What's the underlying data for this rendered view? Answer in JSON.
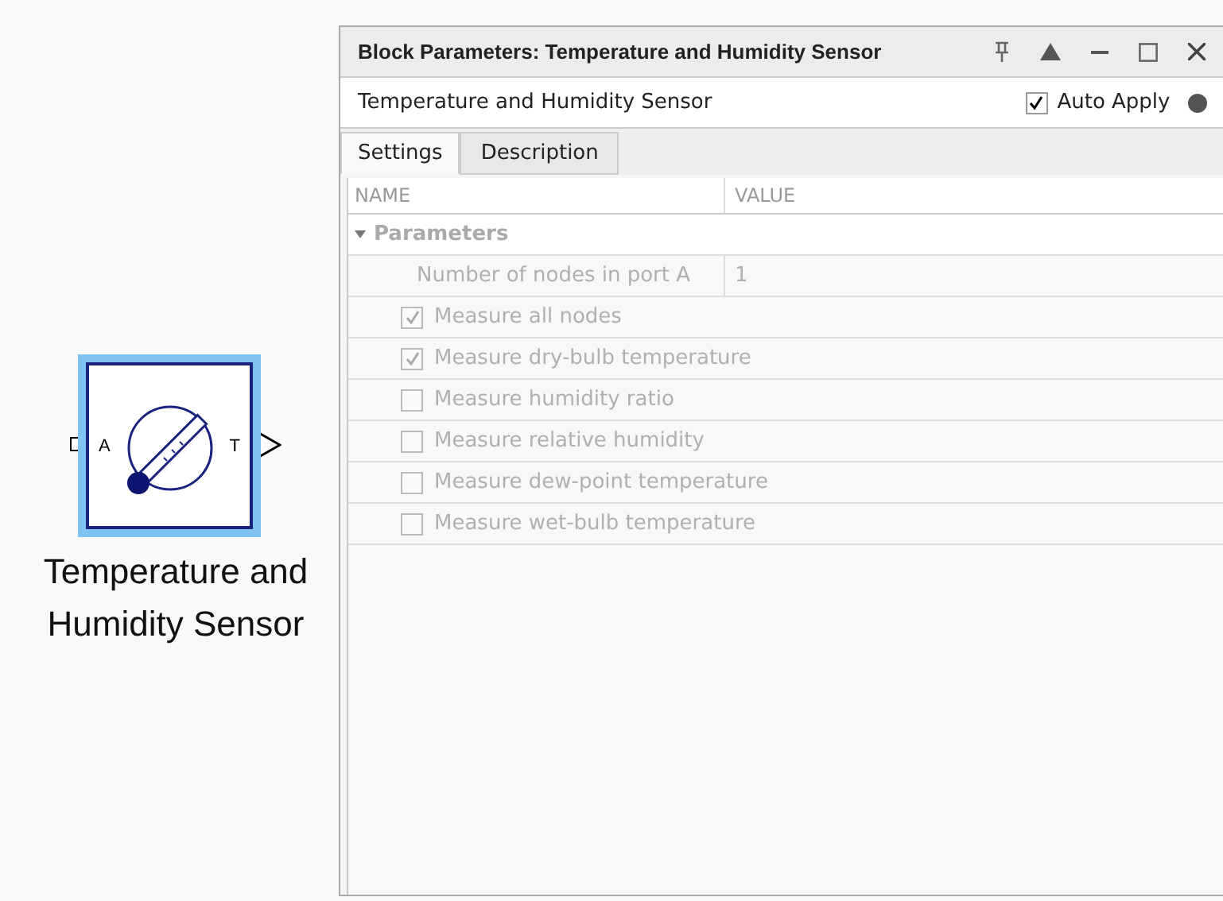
{
  "block": {
    "name_lines": [
      "Temperature and",
      "Humidity Sensor"
    ],
    "port_in": "A",
    "port_out": "T",
    "selected": true
  },
  "dialog": {
    "title": "Block Parameters: Temperature and Humidity Sensor",
    "header": "Temperature and Humidity Sensor",
    "auto_apply": {
      "label": "Auto Apply",
      "checked": true
    },
    "tabs": [
      {
        "label": "Settings",
        "selected": true
      },
      {
        "label": "Description",
        "selected": false
      }
    ],
    "columns": [
      "NAME",
      "VALUE"
    ],
    "group": {
      "label": "Parameters",
      "expanded": true,
      "disabled": true,
      "children": [
        {
          "kind": "number",
          "label": "Number of nodes in port A",
          "value": "1"
        },
        {
          "kind": "checkbox",
          "label": "Measure all nodes",
          "checked": true
        },
        {
          "kind": "checkbox",
          "label": "Measure dry-bulb temperature",
          "checked": true
        },
        {
          "kind": "checkbox",
          "label": "Measure humidity ratio",
          "checked": false
        },
        {
          "kind": "checkbox",
          "label": "Measure relative humidity",
          "checked": false
        },
        {
          "kind": "checkbox",
          "label": "Measure dew-point temperature",
          "checked": false
        },
        {
          "kind": "checkbox",
          "label": "Measure wet-bulb temperature",
          "checked": false
        }
      ]
    }
  }
}
